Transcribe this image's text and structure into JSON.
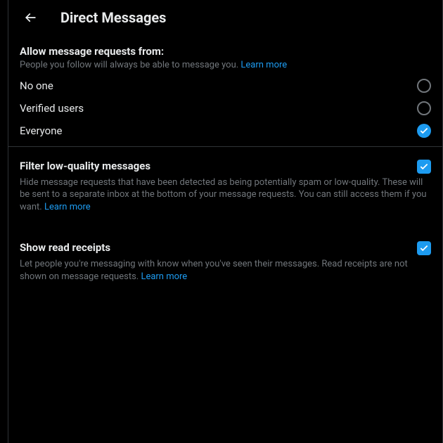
{
  "header": {
    "title": "Direct Messages"
  },
  "allowRequests": {
    "title": "Allow message requests from:",
    "subtext": "People you follow will always be able to message you. ",
    "learnMore": "Learn more",
    "options": [
      {
        "label": "No one",
        "selected": false
      },
      {
        "label": "Verified users",
        "selected": false
      },
      {
        "label": "Everyone",
        "selected": true
      }
    ]
  },
  "filterLowQuality": {
    "title": "Filter low-quality messages",
    "desc": "Hide message requests that have been detected as being potentially spam or low-quality. These will be sent to a separate inbox at the bottom of your message requests. You can still access them if you want. ",
    "learnMore": "Learn more",
    "checked": true
  },
  "readReceipts": {
    "title": "Show read receipts",
    "desc": "Let people you're messaging with know when you've seen their messages. Read receipts are not shown on message requests. ",
    "learnMore": "Learn more",
    "checked": true
  }
}
